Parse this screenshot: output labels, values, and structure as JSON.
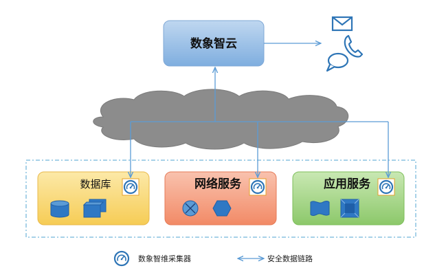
{
  "cloud_service": {
    "label": "数象智云"
  },
  "notify_icons": [
    "mail-icon",
    "phone-icon",
    "chat-bubble-icon"
  ],
  "groups": [
    {
      "label": "数据库",
      "icons": [
        "database-cylinder-icon",
        "stacked-pages-icon"
      ],
      "fill": "#FAD66B"
    },
    {
      "label": "网络服务",
      "icons": [
        "x-circle-icon",
        "hexagon-icon"
      ],
      "fill": "#F59C7C"
    },
    {
      "label": "应用服务",
      "icons": [
        "wave-flag-icon",
        "bevel-square-icon"
      ],
      "fill": "#9DD27C"
    }
  ],
  "legend": {
    "collector_label": "数象智维采集器",
    "link_label": "安全数据链路"
  },
  "colors": {
    "accent_blue": "#2E75B6",
    "line_blue": "#5B9BD5",
    "cloud_gray": "#8C8C8C"
  }
}
